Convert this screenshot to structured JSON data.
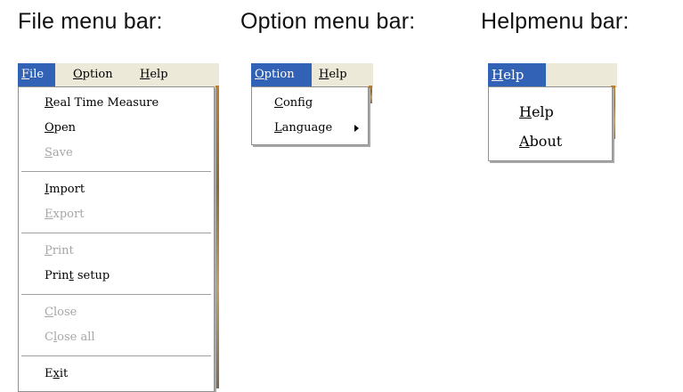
{
  "headings": {
    "file": "File menu bar:",
    "option": "Option menu bar:",
    "help": "Helpmenu bar:"
  },
  "file_menubar": {
    "items": [
      {
        "accel": "F",
        "rest": "ile"
      },
      {
        "accel": "O",
        "rest": "ption"
      },
      {
        "accel": "H",
        "rest": "elp"
      }
    ]
  },
  "file_menu": {
    "items": [
      {
        "pre": "",
        "accel": "R",
        "post": "eal Time Measure",
        "enabled": true
      },
      {
        "pre": "",
        "accel": "O",
        "post": "pen",
        "enabled": true
      },
      {
        "pre": "",
        "accel": "S",
        "post": "ave",
        "enabled": false
      },
      {
        "pre": "",
        "accel": "I",
        "post": "mport",
        "enabled": true
      },
      {
        "pre": "",
        "accel": "E",
        "post": "xport",
        "enabled": false
      },
      {
        "pre": "",
        "accel": "P",
        "post": "rint",
        "enabled": false
      },
      {
        "pre": "Prin",
        "accel": "t",
        "post": " setup",
        "enabled": true
      },
      {
        "pre": "",
        "accel": "C",
        "post": "lose",
        "enabled": false
      },
      {
        "pre": "C",
        "accel": "l",
        "post": "ose all",
        "enabled": false
      },
      {
        "pre": "E",
        "accel": "x",
        "post": "it",
        "enabled": true
      }
    ]
  },
  "option_menubar": {
    "items": [
      {
        "accel": "O",
        "rest": "ption"
      },
      {
        "accel": "H",
        "rest": "elp"
      }
    ]
  },
  "option_menu": {
    "items": [
      {
        "accel": "C",
        "rest": "onfig",
        "submenu": false
      },
      {
        "accel": "L",
        "rest": "anguage",
        "submenu": true
      }
    ]
  },
  "help_menubar": {
    "items": [
      {
        "accel": "H",
        "rest": "elp"
      }
    ]
  },
  "help_menu": {
    "items": [
      {
        "accel": "H",
        "rest": "elp"
      },
      {
        "accel": "A",
        "rest": "bout"
      }
    ]
  },
  "colors": {
    "menubar_bg": "#ece9d8",
    "highlight": "#3162b5",
    "disabled_text": "#a6a6a6"
  },
  "icons": {
    "submenu_arrow": "triangle-right-icon"
  }
}
